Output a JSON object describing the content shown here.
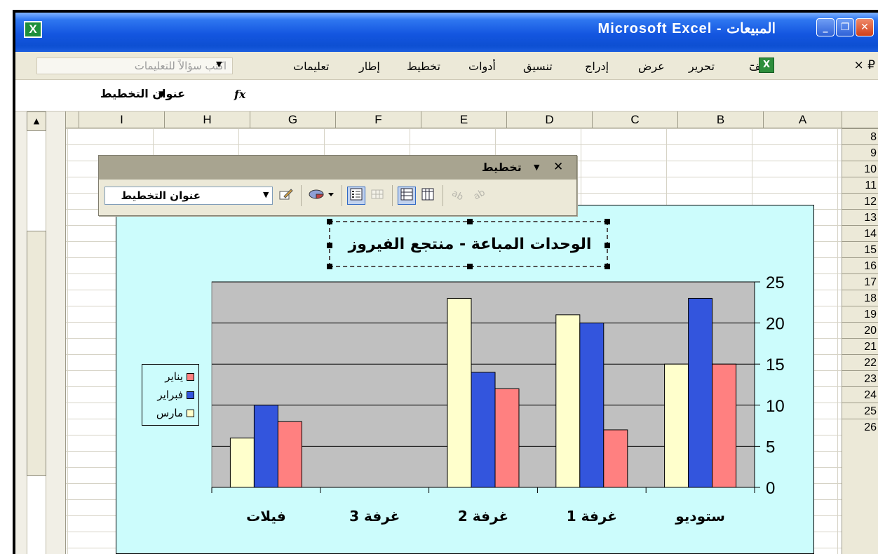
{
  "window": {
    "title": "Microsoft Excel - المبيعات",
    "app_icon": "excel-icon",
    "caption_buttons": [
      "minimize-icon",
      "restore-icon",
      "close-icon"
    ]
  },
  "menu": {
    "items": [
      "ملف",
      "تحرير",
      "عرض",
      "إدراج",
      "تنسيق",
      "أدوات",
      "تخطيط",
      "إطار",
      "تعليمات"
    ],
    "question_placeholder": "اكتب سؤالاً للتعليمات",
    "doc_controls": "× ₽"
  },
  "formula_bar": {
    "name_box": "عنوان التخطيط",
    "fx_label": "fx"
  },
  "sheet": {
    "columns": [
      "I",
      "H",
      "G",
      "F",
      "E",
      "D",
      "C",
      "B",
      "A"
    ],
    "rows": [
      "8",
      "9",
      "10",
      "11",
      "12",
      "13",
      "14",
      "15",
      "16",
      "17",
      "18",
      "19",
      "20",
      "21",
      "22",
      "23",
      "24",
      "25",
      "26"
    ]
  },
  "chart_toolbar": {
    "title": "تخطيط",
    "selected_object": "عنوان التخطيط",
    "buttons": [
      "format-chart-title-icon",
      "chart-type-icon",
      "legend-icon",
      "data-table-icon",
      "by-row-icon",
      "by-column-icon",
      "angle-text-downward-icon",
      "angle-text-upward-icon"
    ]
  },
  "chart_data": {
    "type": "bar",
    "title": "الوحدات المباعة - منتجع الفيروز",
    "categories": [
      "ستوديو",
      "غرفة 1",
      "غرفة 2",
      "غرفة 3",
      "فيلات"
    ],
    "series": [
      {
        "name": "يناير",
        "values": [
          15,
          7,
          12,
          0,
          8
        ],
        "color": "#ff8080"
      },
      {
        "name": "فبراير",
        "values": [
          23,
          20,
          14,
          0,
          10
        ],
        "color": "#3355dd"
      },
      {
        "name": "مارس",
        "values": [
          15,
          21,
          23,
          0,
          6
        ],
        "color": "#ffffcc"
      }
    ],
    "ylim": [
      0,
      25
    ],
    "yticks": [
      "0",
      "5",
      "10",
      "15",
      "20",
      "25"
    ],
    "grid": true,
    "legend": "left",
    "plot_color": "#c0c0c0",
    "chart_color": "#ccfcfc"
  }
}
